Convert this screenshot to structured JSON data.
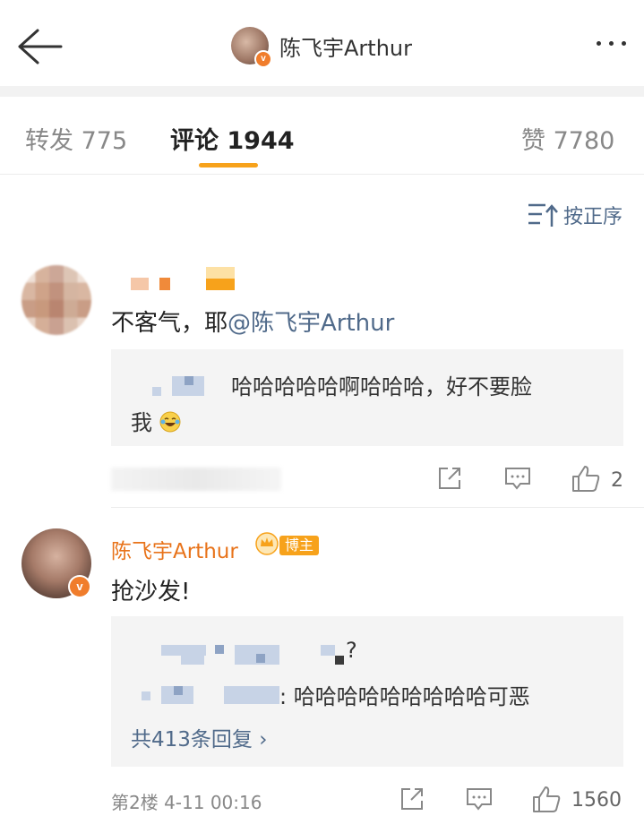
{
  "nav": {
    "title": "陈飞宇Arthur",
    "badge": "v"
  },
  "tabs": [
    {
      "label": "转发 775"
    },
    {
      "label": "评论 1944"
    },
    {
      "label": "赞 7780"
    }
  ],
  "sort": {
    "label": "按正序"
  },
  "comments": [
    {
      "text_prefix": "不客气，耶",
      "mention": "@陈飞宇Arthur",
      "reply": {
        "line1": "哈哈哈哈哈啊哈哈哈，好不要脸",
        "line2": "我"
      },
      "likes": "2"
    },
    {
      "author": "陈飞宇Arthur",
      "author_tag": "博主",
      "badge": "v",
      "text": "抢沙发!",
      "reply": {
        "line1_end": "?",
        "line2": ": 哈哈哈哈哈哈哈哈哈可恶",
        "more": "共413条回复 ›"
      },
      "meta": "第2楼 4-11 00:16",
      "likes": "1560"
    }
  ],
  "colors": {
    "accent": "#f7a21b",
    "link": "#506a8a",
    "author": "#e8731a"
  }
}
